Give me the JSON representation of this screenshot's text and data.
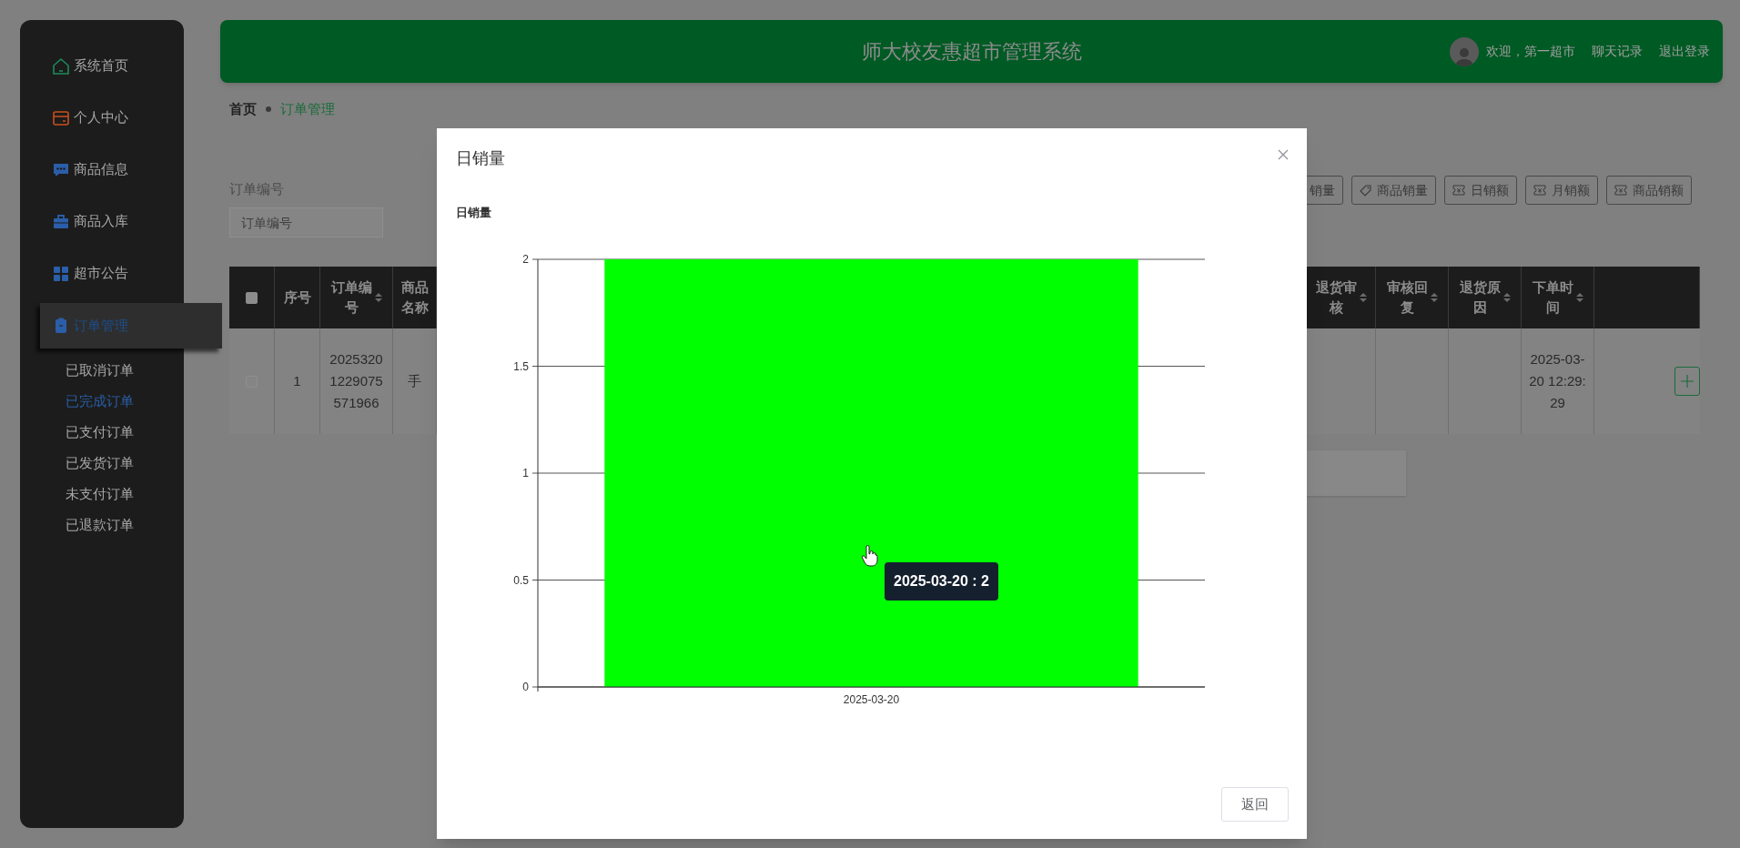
{
  "header": {
    "title": "师大校友惠超市管理系统",
    "greeting": "欢迎，第一超市",
    "links": [
      "聊天记录",
      "退出登录"
    ]
  },
  "sidebar": {
    "items": [
      {
        "label": "系统首页",
        "selected": false
      },
      {
        "label": "个人中心",
        "selected": false
      },
      {
        "label": "商品信息",
        "selected": false
      },
      {
        "label": "商品入库",
        "selected": false
      },
      {
        "label": "超市公告",
        "selected": false
      },
      {
        "label": "订单管理",
        "selected": true,
        "expanded": true,
        "children": [
          {
            "label": "已取消订单",
            "selected": false
          },
          {
            "label": "已完成订单",
            "selected": true
          },
          {
            "label": "已支付订单",
            "selected": false
          },
          {
            "label": "已发货订单",
            "selected": false
          },
          {
            "label": "未支付订单",
            "selected": false
          },
          {
            "label": "已退款订单",
            "selected": false
          }
        ]
      }
    ]
  },
  "breadcrumb": [
    {
      "label": "首页",
      "current": false
    },
    {
      "label": "订单管理",
      "current": true
    }
  ],
  "search": {
    "label": "订单编号",
    "placeholder": "订单编号"
  },
  "toolbar_buttons": [
    {
      "label": "销量",
      "kind": "plain"
    },
    {
      "label": "商品销量",
      "kind": "tag"
    },
    {
      "label": "日销额",
      "kind": "ticket"
    },
    {
      "label": "月销额",
      "kind": "ticket"
    },
    {
      "label": "商品销额",
      "kind": "ticket"
    }
  ],
  "table": {
    "header_checked": false,
    "columns_left": [
      {
        "label": "序号",
        "sortable": false
      },
      {
        "label": "订单编号",
        "sortable": true
      },
      {
        "label": "商品名称",
        "sortable": false
      }
    ],
    "columns_right": [
      {
        "label": "退货审核",
        "sortable": true
      },
      {
        "label": "审核回复",
        "sortable": true
      },
      {
        "label": "退货原因",
        "sortable": true
      },
      {
        "label": "下单时间",
        "sortable": true
      }
    ],
    "rows": [
      {
        "checked": false,
        "index": "1",
        "order_number": "20253201229075571966",
        "product": "手",
        "order_time": "2025-03-20 12:29:29"
      }
    ]
  },
  "modal": {
    "title": "日销量",
    "chart_data": {
      "type": "bar",
      "title": "日销量",
      "categories": [
        "2025-03-20"
      ],
      "series": [
        {
          "color": "#00ff00",
          "values": [
            2
          ]
        }
      ],
      "grid": true,
      "ylim": [
        0,
        2
      ],
      "yticks": [
        0,
        0.5,
        1,
        1.5,
        2
      ]
    },
    "tooltip": "2025-03-20 : 2",
    "buttons": [
      "返回"
    ]
  }
}
